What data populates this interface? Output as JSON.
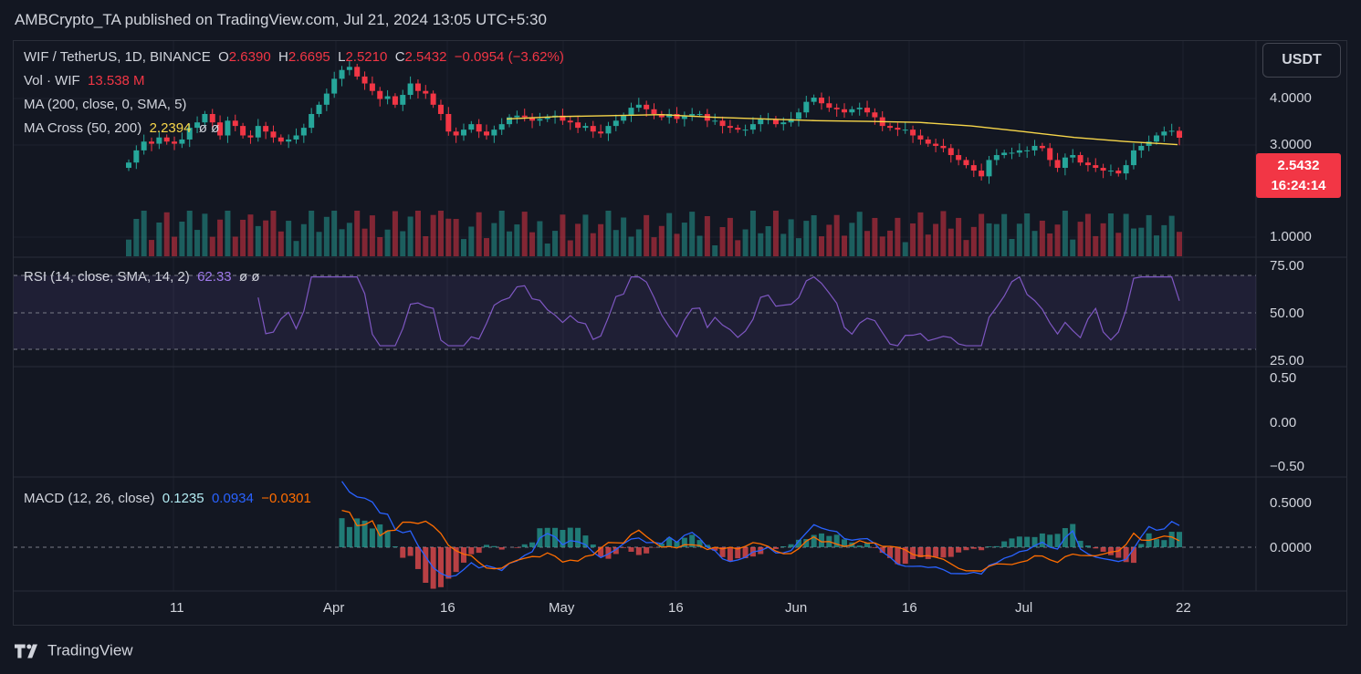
{
  "header": {
    "publisher_line": "AMBCrypto_TA published on TradingView.com, Jul 21, 2024 13:05 UTC+5:30"
  },
  "legend": {
    "symbol": "WIF / TetherUS, 1D, BINANCE",
    "o_label": "O",
    "o_value": "2.6390",
    "h_label": "H",
    "h_value": "2.6695",
    "l_label": "L",
    "l_value": "2.5210",
    "c_label": "C",
    "c_value": "2.5432",
    "change": "−0.0954 (−3.62%)",
    "vol_label": "Vol · WIF",
    "vol_value": "13.538 M",
    "ma_label": "MA (200, close, 0, SMA, 5)",
    "macross_label": "MA Cross (50, 200)",
    "macross_value": "2.2394",
    "macross_na": "ø  ø",
    "rsi_label": "RSI (14, close, SMA, 14, 2)",
    "rsi_value": "62.33",
    "rsi_na": "ø  ø",
    "macd_label": "MACD (12, 26, close)",
    "macd_hist": "0.1235",
    "macd_line": "0.0934",
    "macd_signal": "−0.0301"
  },
  "currency_button": "USDT",
  "last_price": {
    "price": "2.5432",
    "countdown": "16:24:14"
  },
  "price_axis": [
    "4.0000",
    "3.0000",
    "1.0000"
  ],
  "rsi_axis": [
    "75.00",
    "50.00",
    "25.00"
  ],
  "mid_axis": [
    "0.50",
    "0.00",
    "−0.50"
  ],
  "macd_axis": [
    "0.5000",
    "0.0000"
  ],
  "time_axis": [
    "11",
    "Apr",
    "16",
    "May",
    "16",
    "Jun",
    "16",
    "Jul",
    "22"
  ],
  "footer": {
    "brand": "TradingView"
  },
  "colors": {
    "up": "#26a69a",
    "down": "#f23645",
    "ma": "#f7d64a",
    "rsi": "#7e57c2",
    "macd": "#2962ff",
    "signal": "#ff6d00",
    "bg": "#131722"
  },
  "chart_data": {
    "type": "candlestick",
    "symbol": "WIF / TetherUS",
    "interval": "1D",
    "y_scale": "log",
    "price_range": [
      0.8,
      5.2
    ],
    "dates": [
      "2024-03-07",
      "2024-07-21"
    ],
    "close": [
      2.0,
      2.25,
      2.45,
      2.4,
      2.55,
      2.45,
      2.4,
      2.5,
      2.8,
      2.95,
      3.2,
      2.95,
      2.6,
      3.0,
      2.85,
      2.6,
      2.55,
      2.85,
      2.7,
      2.55,
      2.45,
      2.5,
      2.6,
      2.8,
      3.2,
      3.5,
      3.9,
      4.5,
      4.9,
      5.05,
      4.6,
      4.3,
      4.0,
      3.7,
      3.8,
      3.5,
      3.85,
      4.3,
      4.0,
      3.9,
      3.5,
      3.2,
      2.7,
      2.6,
      2.75,
      2.9,
      2.7,
      2.6,
      2.75,
      2.9,
      3.1,
      3.15,
      3.1,
      3.0,
      3.05,
      3.1,
      3.15,
      3.0,
      2.95,
      2.8,
      2.85,
      2.7,
      2.65,
      2.85,
      3.0,
      3.15,
      3.4,
      3.5,
      3.35,
      3.2,
      3.1,
      3.2,
      3.05,
      3.15,
      3.2,
      3.2,
      3.0,
      3.0,
      2.85,
      2.8,
      2.75,
      2.75,
      2.9,
      3.05,
      3.05,
      2.9,
      2.95,
      3.05,
      3.25,
      3.6,
      3.75,
      3.55,
      3.4,
      3.35,
      3.25,
      3.35,
      3.4,
      3.25,
      3.1,
      2.85,
      2.8,
      2.75,
      2.75,
      2.6,
      2.5,
      2.4,
      2.35,
      2.3,
      2.15,
      2.05,
      1.95,
      1.85,
      1.75,
      2.05,
      2.15,
      2.2,
      2.2,
      2.25,
      2.25,
      2.35,
      2.3,
      2.05,
      1.9,
      2.1,
      2.15,
      2.0,
      1.95,
      1.9,
      1.85,
      1.85,
      1.8,
      1.95,
      2.25,
      2.35,
      2.45,
      2.6,
      2.7,
      2.72,
      2.5432
    ],
    "ma200": [
      3.05,
      3.12,
      3.15,
      3.18,
      3.1,
      3.05,
      3.0,
      2.98,
      2.95,
      2.85,
      2.7,
      2.55,
      2.45,
      2.38
    ],
    "volume_last": "13.538M",
    "rsi_last": 62.33,
    "rsi_bands": [
      70,
      50,
      30
    ],
    "macd": {
      "macd": 0.0934,
      "signal": -0.0301,
      "histogram": 0.1235
    }
  }
}
